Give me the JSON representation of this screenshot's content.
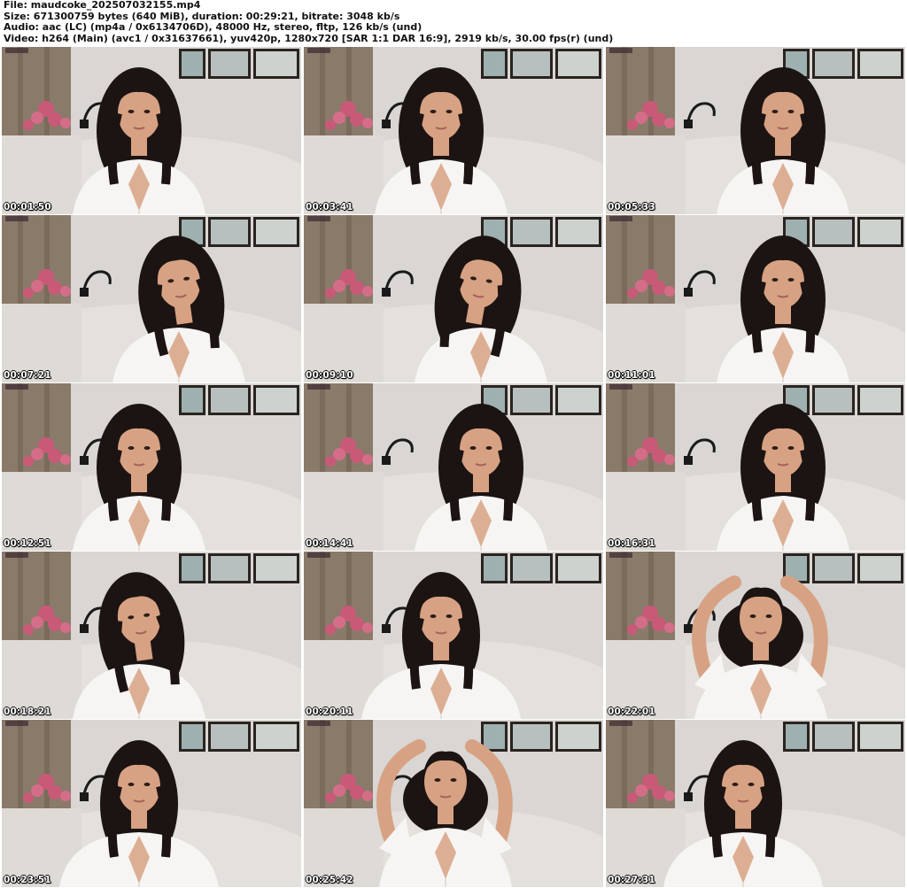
{
  "header": {
    "file_line": "File: maudcoke_202507032155.mp4",
    "size_line": "Size: 671300759 bytes (640 MiB), duration: 00:29:21, bitrate: 3048 kb/s",
    "audio_line": "Audio: aac (LC) (mp4a / 0x6134706D), 48000 Hz, stereo, fltp, 126 kb/s (und)",
    "video_line": "Video: h264 (Main) (avc1 / 0x31637661), yuv420p, 1280x720 [SAR 1:1 DAR 16:9], 2919 kb/s, 30.00 fps(r) (und)"
  },
  "thumbnails": [
    {
      "timestamp": "00:01:50",
      "pose": "center-shoulders"
    },
    {
      "timestamp": "00:03:41",
      "pose": "center-talk"
    },
    {
      "timestamp": "00:05:33",
      "pose": "right-talk"
    },
    {
      "timestamp": "00:07:21",
      "pose": "right-tilt"
    },
    {
      "timestamp": "00:09:10",
      "pose": "right-look-down"
    },
    {
      "timestamp": "00:11:01",
      "pose": "right-talk"
    },
    {
      "timestamp": "00:12:51",
      "pose": "center-talk"
    },
    {
      "timestamp": "00:14:41",
      "pose": "right-talk"
    },
    {
      "timestamp": "00:16:31",
      "pose": "right-smile"
    },
    {
      "timestamp": "00:18:21",
      "pose": "center-tilt"
    },
    {
      "timestamp": "00:20:11",
      "pose": "center-wide"
    },
    {
      "timestamp": "00:22:01",
      "pose": "arms-up"
    },
    {
      "timestamp": "00:23:51",
      "pose": "center-wide"
    },
    {
      "timestamp": "00:25:42",
      "pose": "arms-up-center"
    },
    {
      "timestamp": "00:27:31",
      "pose": "center-wide"
    }
  ],
  "colors": {
    "wall": "#d9d6d3",
    "curtain": "#8a7a6a",
    "sofa": "#e4e0dc",
    "flowers": "#c85a78",
    "hair": "#1c1412",
    "skin": "#d7a283",
    "shirt": "#f6f5f3",
    "frame": "#2a2420"
  }
}
